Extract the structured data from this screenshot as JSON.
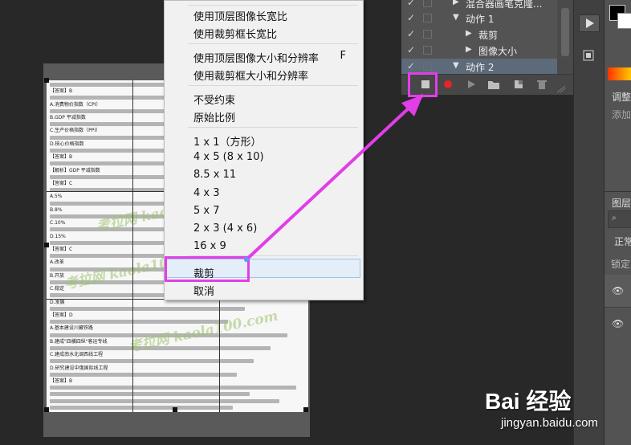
{
  "menu": {
    "items": [
      {
        "label": "使用顶层图像长宽比",
        "shortcut": ""
      },
      {
        "label": "使用裁剪框长宽比",
        "shortcut": ""
      },
      {
        "label": "使用顶层图像大小和分辨率",
        "shortcut": "F"
      },
      {
        "label": "使用裁剪框大小和分辨率",
        "shortcut": ""
      },
      {
        "label": "不受约束",
        "shortcut": ""
      },
      {
        "label": "原始比例",
        "shortcut": ""
      },
      {
        "label": "1 x 1（方形）",
        "shortcut": ""
      },
      {
        "label": "4 x 5 (8 x 10)",
        "shortcut": ""
      },
      {
        "label": "8.5 x 11",
        "shortcut": ""
      },
      {
        "label": "4 x 3",
        "shortcut": ""
      },
      {
        "label": "5 x 7",
        "shortcut": ""
      },
      {
        "label": "2 x 3 (4 x 6)",
        "shortcut": ""
      },
      {
        "label": "16 x 9",
        "shortcut": ""
      },
      {
        "label": "裁剪",
        "shortcut": ""
      },
      {
        "label": "取消",
        "shortcut": ""
      }
    ],
    "highlighted": "裁剪"
  },
  "actions_panel": {
    "rows": [
      {
        "label": "混合器画笔克隆...",
        "checked": true,
        "expanded": false
      },
      {
        "label": "动作 1",
        "checked": true,
        "expanded": true
      },
      {
        "label": "裁剪",
        "checked": true,
        "expanded": false
      },
      {
        "label": "图像大小",
        "checked": true,
        "expanded": false
      },
      {
        "label": "动作 2",
        "checked": true,
        "expanded": true,
        "selected": true
      }
    ],
    "toolbar_icons": [
      "stop-icon",
      "record-icon",
      "play-icon",
      "folder-icon",
      "new-action-icon",
      "trash-icon"
    ]
  },
  "right_panel": {
    "adjust_title": "调整",
    "add_text": "添加",
    "layers_title": "图层",
    "blend_mode": "正常",
    "lock_label": "锁定"
  },
  "document": {
    "snippets": [
      "【答案】B",
      "A.消费物价指数（CPI）",
      "B.GDP 平减指数",
      "C.生产价格指数（PPI）",
      "D.核心价格指数",
      "【答案】B",
      "【解析】GDP 平减指数",
      "【答案】C",
      "A.5%",
      "B.8%",
      "C.10%",
      "D.15%",
      "【答案】C",
      "A.改革",
      "B.开放",
      "C.稳定",
      "D.发展",
      "【答案】D",
      "A.基本建设川藏铁路",
      "B.建成\"四横四纵\"客运专线",
      "C.建成南水北调西线工程",
      "D.研究建设中俄国际线工程",
      "【答案】B"
    ],
    "watermark": "考拉网 kaola100.com"
  },
  "branding": {
    "baidu": "Bai 经验",
    "url": "jingyan.baidu.com"
  },
  "colors": {
    "annotation": "#e13ee8",
    "menu_bg": "#f1f1f1",
    "panel_bg": "#535353"
  }
}
